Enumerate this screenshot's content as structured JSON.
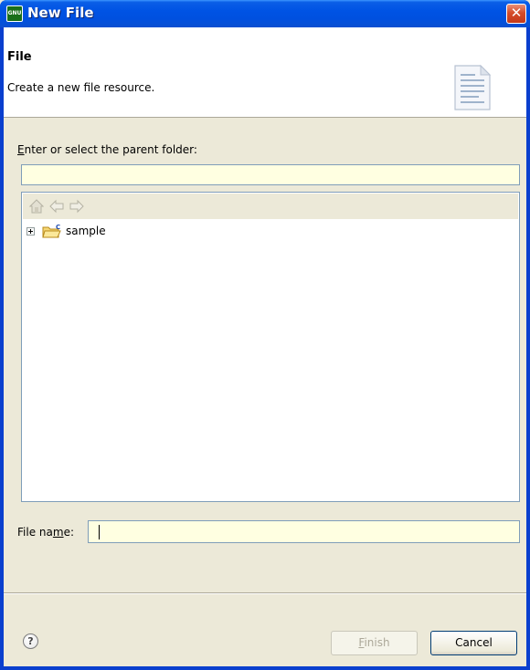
{
  "window": {
    "title": "New File",
    "app_icon_text": "GNU"
  },
  "header": {
    "title": "File",
    "description": "Create a new file resource."
  },
  "folder": {
    "label_accel": "E",
    "label_rest": "nter or select the parent folder:",
    "value": ""
  },
  "tree": {
    "items": [
      {
        "label": "sample",
        "expanded": false,
        "icon": "project-folder-icon"
      }
    ]
  },
  "filename": {
    "label_pre": "File na",
    "label_accel": "m",
    "label_post": "e:",
    "value": ""
  },
  "buttons": {
    "finish_accel": "F",
    "finish_rest": "inish",
    "finish_enabled": false,
    "cancel": "Cancel"
  },
  "colors": {
    "titlebar": "#0053e4",
    "input_background": "#ffffe1",
    "dialog_background": "#ece9d8"
  }
}
